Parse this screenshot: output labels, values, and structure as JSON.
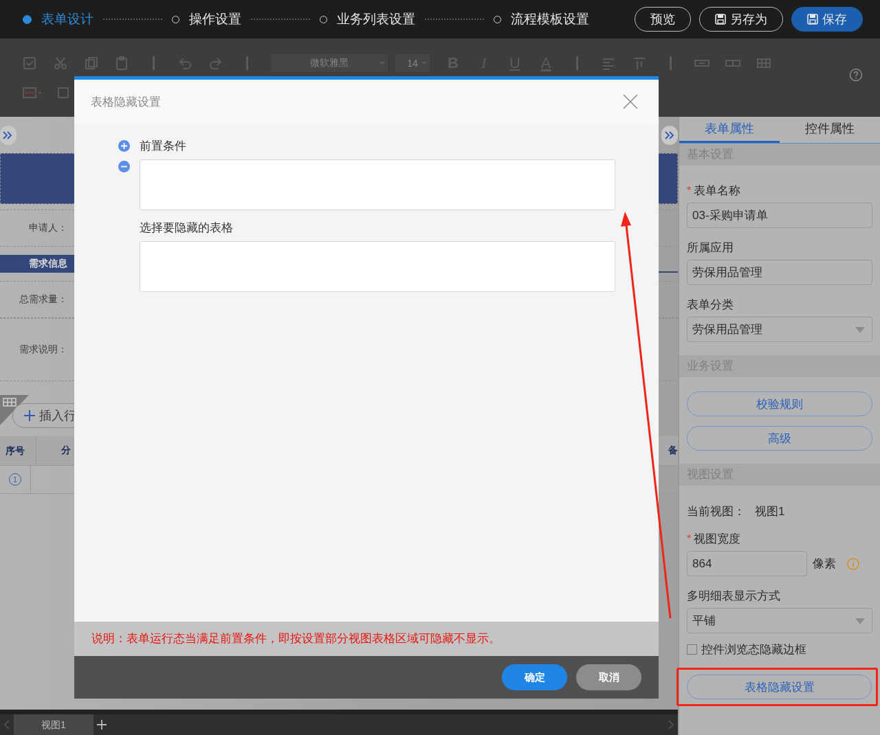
{
  "top_bar": {
    "steps": [
      {
        "label": "表单设计",
        "selected": true
      },
      {
        "label": "操作设置",
        "selected": false
      },
      {
        "label": "业务列表设置",
        "selected": false
      },
      {
        "label": "流程模板设置",
        "selected": false
      }
    ],
    "buttons": [
      {
        "label": "预览",
        "kind": "outline"
      },
      {
        "label": "另存为",
        "kind": "outline_icon"
      },
      {
        "label": "保存",
        "kind": "primary"
      }
    ]
  },
  "toolbar": {
    "font": "微软雅黑",
    "size": "14",
    "format_buttons": [
      "B",
      "I",
      "U",
      "A"
    ]
  },
  "canvas": {
    "rows": [
      {
        "kind": "field",
        "label": "申请人："
      },
      {
        "kind": "section",
        "label": "需求信息"
      },
      {
        "kind": "field",
        "label": "总需求量："
      },
      {
        "kind": "tall",
        "label": "需求说明："
      }
    ],
    "insert_button": "插入行",
    "table": {
      "columns": [
        {
          "label": "序号"
        },
        {
          "label": "分"
        },
        {
          "label": "备"
        }
      ],
      "rows": [
        {
          "index": "1"
        }
      ]
    }
  },
  "dialog": {
    "title": "表格隐藏设置",
    "condition_label": "前置条件",
    "target_label": "选择要隐藏的表格",
    "note": "说明：表单运行态当满足前置条件，即按设置部分视图表格区域可隐藏不显示。",
    "buttons": [
      {
        "label": "确定",
        "kind": "primary"
      },
      {
        "label": "取消",
        "kind": "secondary"
      }
    ]
  },
  "panel": {
    "tabs": [
      {
        "label": "表单属性",
        "selected": true
      },
      {
        "label": "控件属性",
        "selected": false
      }
    ],
    "items": [
      {
        "kind": "section",
        "label": "基本设置"
      },
      {
        "kind": "input",
        "label": "表单名称",
        "required_mark": "*",
        "value": "03-采购申请单"
      },
      {
        "kind": "input",
        "label": "所属应用",
        "value": "劳保用品管理"
      },
      {
        "kind": "select",
        "label": "表单分类",
        "value": "劳保用品管理"
      },
      {
        "kind": "section",
        "label": "业务设置"
      },
      {
        "kind": "button",
        "label": "校验规则",
        "highlighted": false
      },
      {
        "kind": "button",
        "label": "高级",
        "highlighted": false
      },
      {
        "kind": "section",
        "label": "视图设置"
      },
      {
        "kind": "info",
        "label": "当前视图：",
        "value": "视图1"
      },
      {
        "kind": "unit_input",
        "label": "视图宽度",
        "required_mark": "*",
        "value": "864",
        "unit": "像素"
      },
      {
        "kind": "select",
        "label": "多明细表显示方式",
        "value": "平铺"
      },
      {
        "kind": "checkbox",
        "label": "控件浏览态隐藏边框",
        "checked": false
      },
      {
        "kind": "button",
        "label": "表格隐藏设置",
        "highlighted": true
      }
    ]
  },
  "bottom_bar": {
    "view_tabs": [
      {
        "label": "视图1",
        "selected": true
      }
    ]
  }
}
